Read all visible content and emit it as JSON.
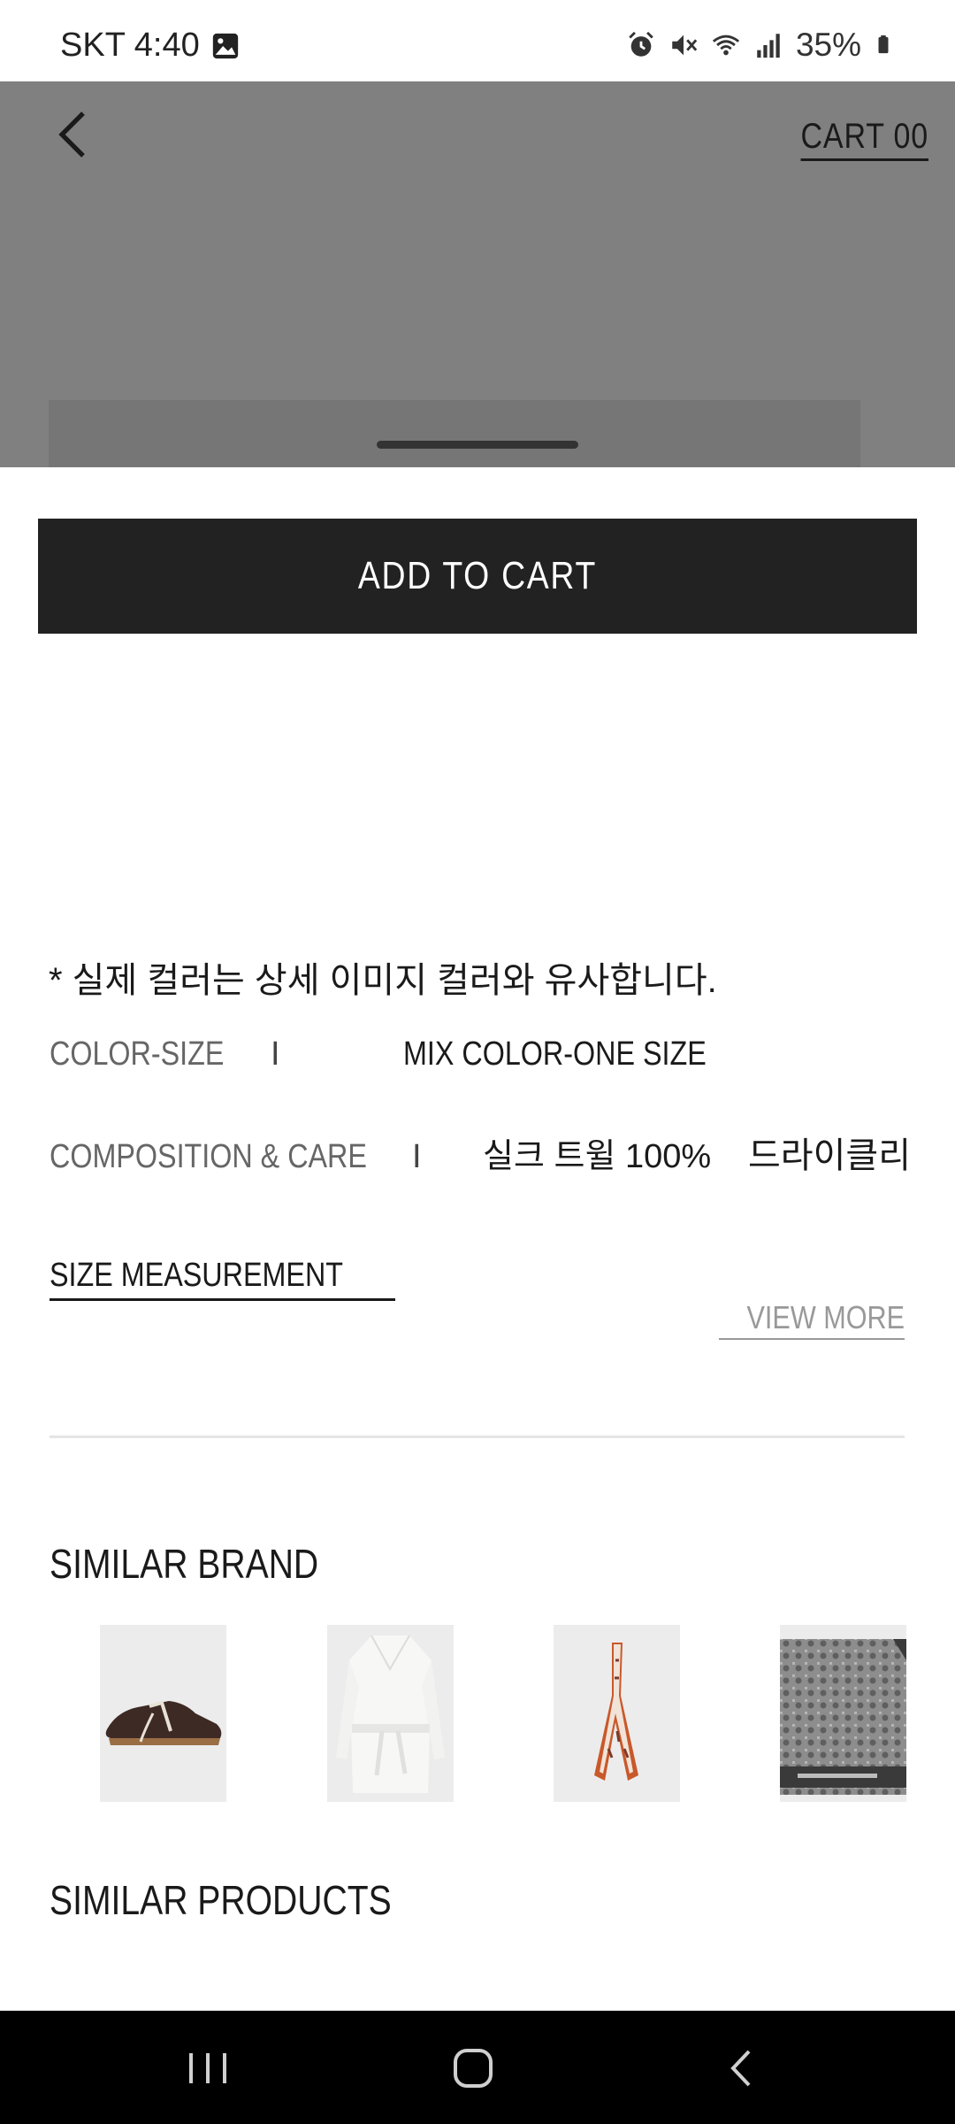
{
  "status_bar": {
    "carrier_time": "SKT 4:40",
    "battery": "35%"
  },
  "header": {
    "cart_label": "CART 00"
  },
  "actions": {
    "add_to_cart": "ADD TO CART"
  },
  "details": {
    "notice": "* 실제 컬러는 상세 이미지 컬러와 유사합니다.",
    "color_size_label": "COLOR-SIZE",
    "color_size_value": "MIX COLOR-ONE SIZE",
    "composition_label": "COMPOSITION & CARE",
    "composition_value": "실크 트윌 100%",
    "care_value": "드라이클리",
    "separator": "I",
    "size_measurement": "SIZE MEASUREMENT",
    "view_more": "VIEW MORE"
  },
  "sections": {
    "similar_brand": "SIMILAR BRAND",
    "similar_products": "SIMILAR PRODUCTS"
  },
  "similar_brand_items": [
    {
      "icon": "sneaker-image"
    },
    {
      "icon": "white-robe-image"
    },
    {
      "icon": "silk-twilly-scarf-image"
    },
    {
      "icon": "monogram-scarf-image"
    }
  ],
  "colors": {
    "button_bg": "#222222",
    "dim_overlay": "#808080",
    "nav_bar": "#000000"
  }
}
